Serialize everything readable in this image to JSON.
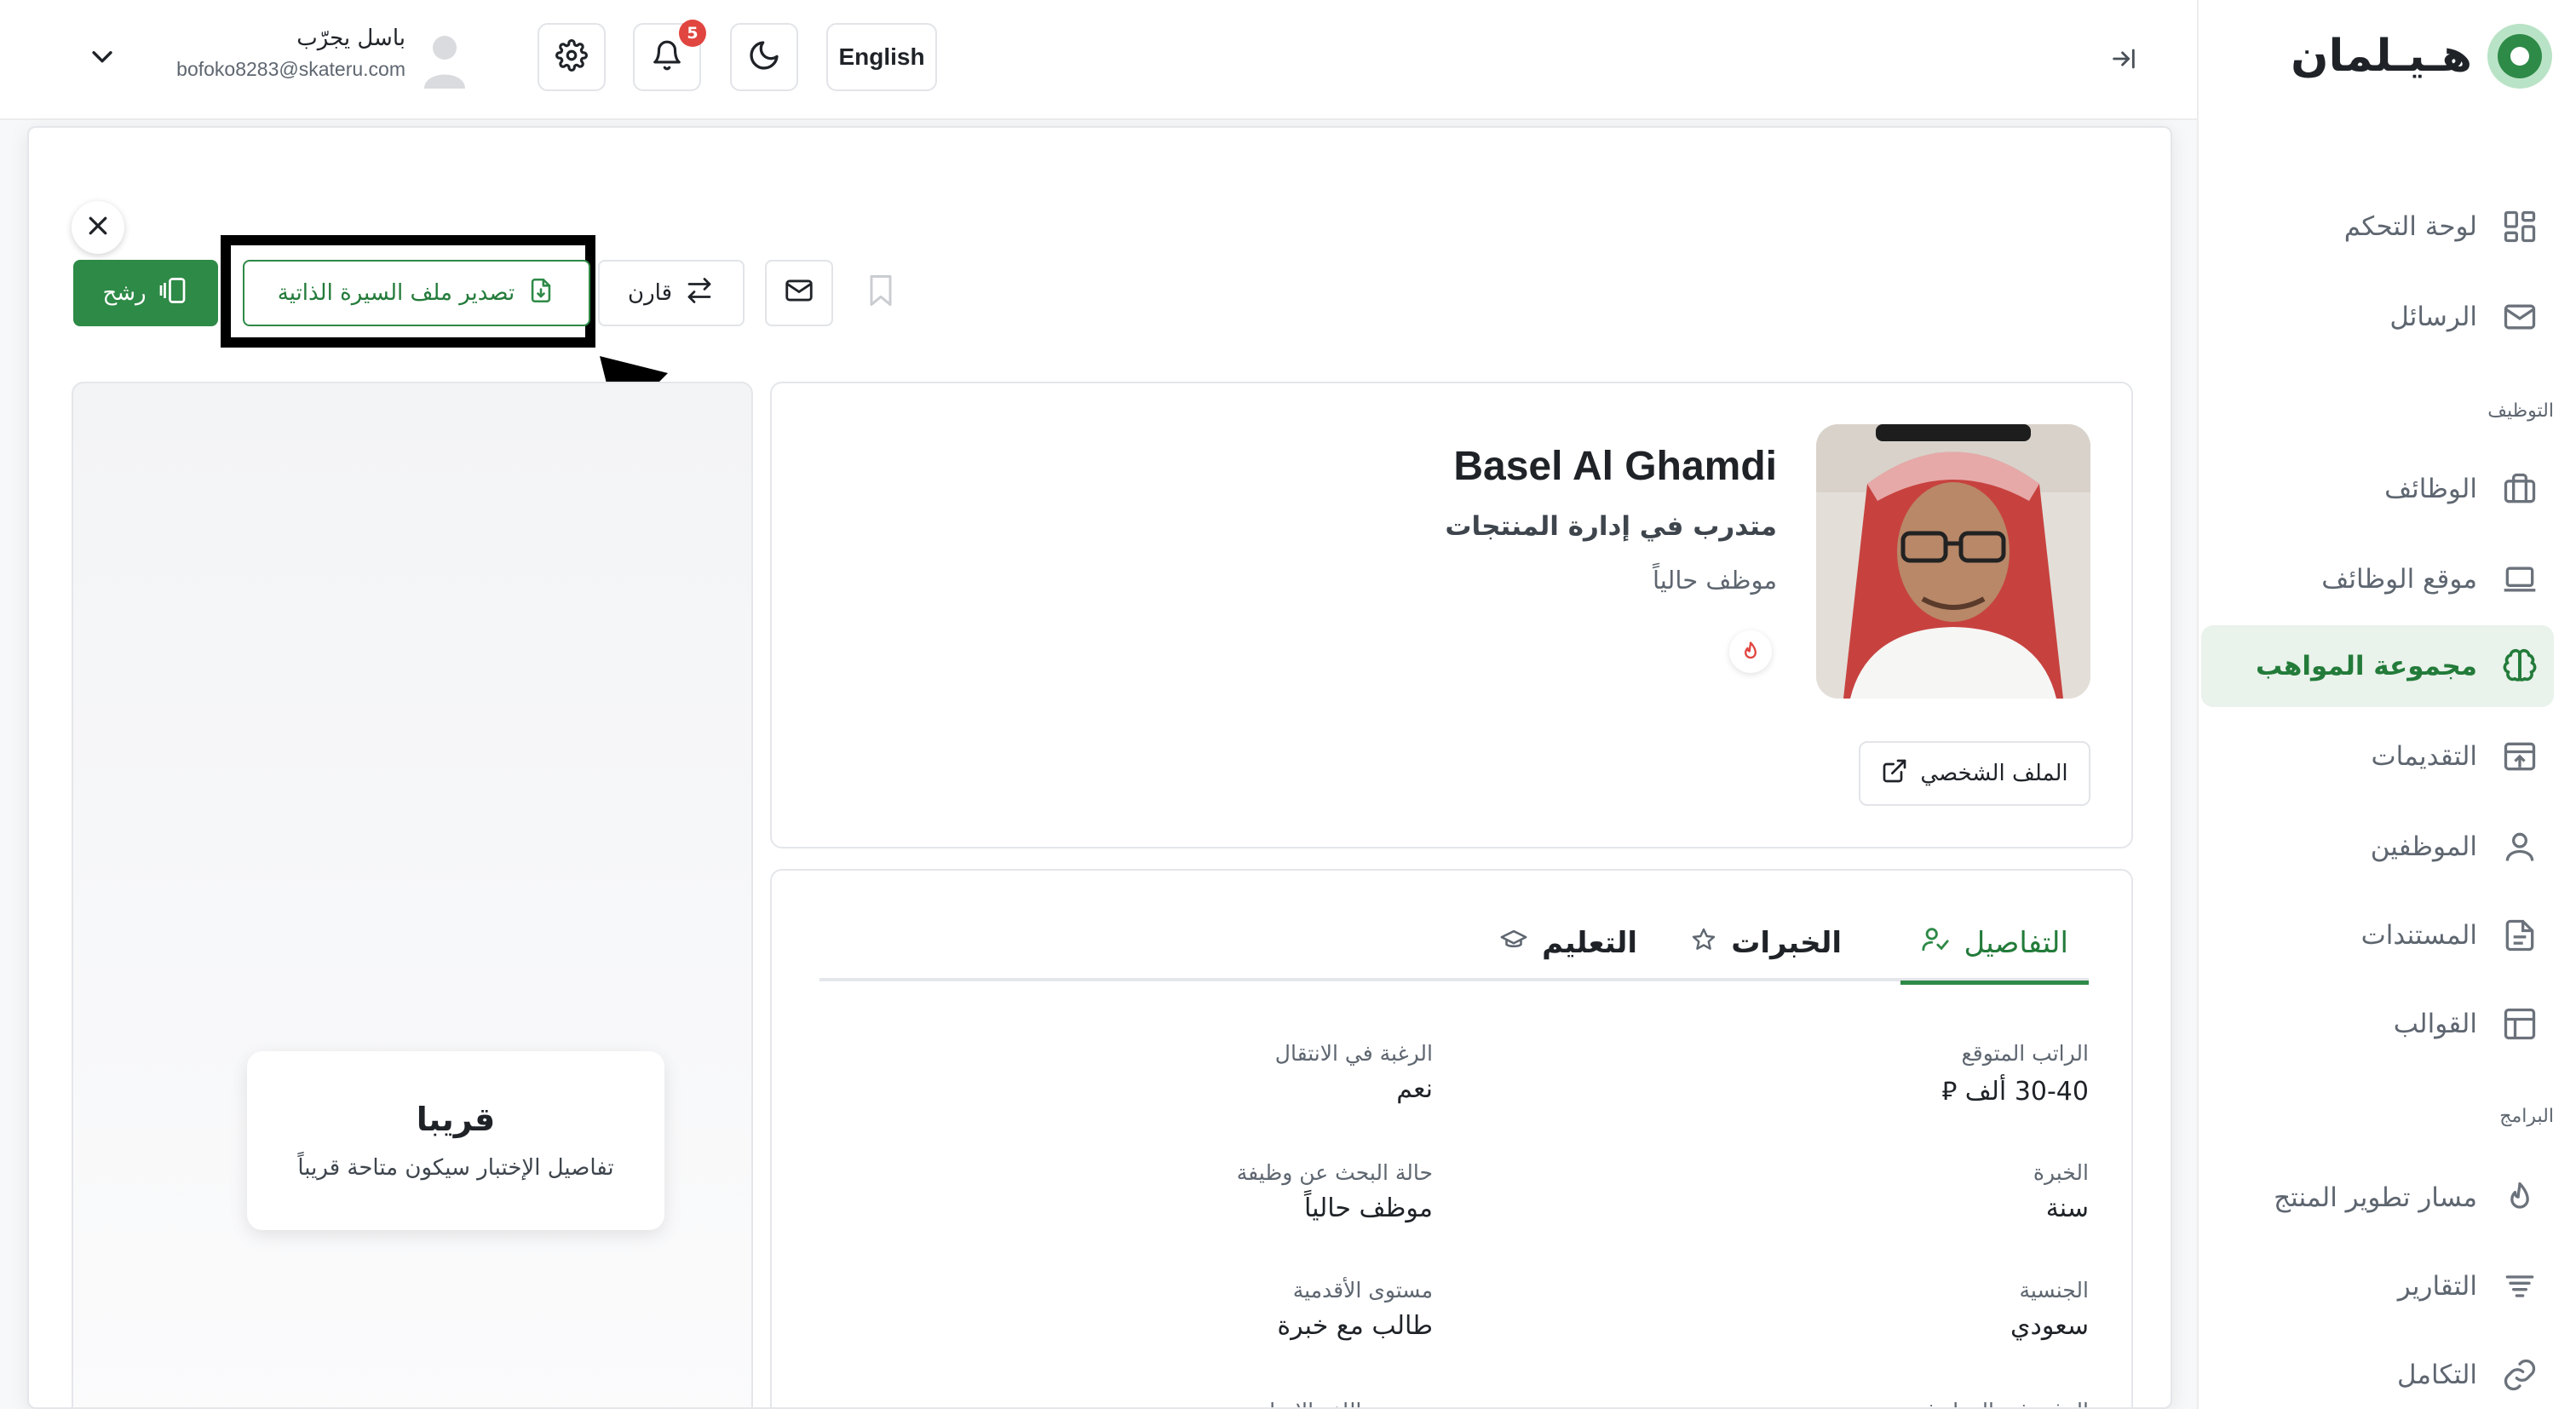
{
  "sidebar": {
    "brand_name": "هـيـلمان",
    "items": [
      {
        "label": "لوحة التحكم",
        "icon": "dashboard-grid-icon"
      },
      {
        "label": "الرسائل",
        "icon": "mail-icon"
      },
      {
        "label": "الوظائف",
        "icon": "briefcase-icon"
      },
      {
        "label": "موقع الوظائف",
        "icon": "laptop-icon"
      },
      {
        "label": "مجموعة المواهب",
        "icon": "brain-icon"
      },
      {
        "label": "التقديمات",
        "icon": "inbox-upload-icon"
      },
      {
        "label": "الموظفين",
        "icon": "user-icon"
      },
      {
        "label": "المستندات",
        "icon": "document-icon"
      },
      {
        "label": "القوالب",
        "icon": "layout-template-icon"
      },
      {
        "label": "مسار تطوير المنتج",
        "icon": "flame-icon"
      },
      {
        "label": "التقارير",
        "icon": "report-lines-icon"
      },
      {
        "label": "التكامل",
        "icon": "link-icon"
      }
    ],
    "sections": {
      "recruitment": "التوظيف",
      "programs": "البرامج"
    },
    "active_item": "مجموعة المواهب"
  },
  "topbar": {
    "language": "English",
    "notifications_count": "5",
    "user_name": "باسل يجرّب",
    "user_email": "bofoko8283@skateru.com"
  },
  "modal": {
    "actions": {
      "nominate": "رشح",
      "export_cv": "تصدير ملف السيرة الذاتية",
      "compare": "قارن"
    },
    "coming_soon": {
      "title": "قريبا",
      "description": "تفاصيل الإختبار سيكون متاحة قريباً"
    },
    "candidate": {
      "name": "Basel Al Ghamdi",
      "title": "متدرب في إدارة المنتجات",
      "status": "موظف حالياً",
      "profile_link": "الملف الشخصي"
    },
    "tabs": {
      "details": "التفاصيل",
      "experience": "الخبرات",
      "education": "التعليم"
    },
    "fields": {
      "expected_salary": {
        "label": "الراتب المتوقع",
        "value": "30-40 ألف ⃁"
      },
      "relocation": {
        "label": "الرغبة في الانتقال",
        "value": "نعم"
      },
      "experience": {
        "label": "الخبرة",
        "value": "سنة"
      },
      "job_search_status": {
        "label": "حالة البحث عن وظيفة",
        "value": "موظف حالياً"
      },
      "nationality": {
        "label": "الجنسية",
        "value": "سعودي"
      },
      "seniority": {
        "label": "مستوى الأقدمية",
        "value": "طالب مع خبرة"
      },
      "work_preference": {
        "label": "الرغبة في العمل في",
        "value": ""
      },
      "english_level": {
        "label": "مستوى اللغة الإنجليزية",
        "value": ""
      }
    }
  },
  "colors": {
    "brand_green": "#2e8a47",
    "active_nav_bg": "#e9f2eb",
    "badge_red": "#e1453f",
    "annotation_black": "#000000"
  }
}
